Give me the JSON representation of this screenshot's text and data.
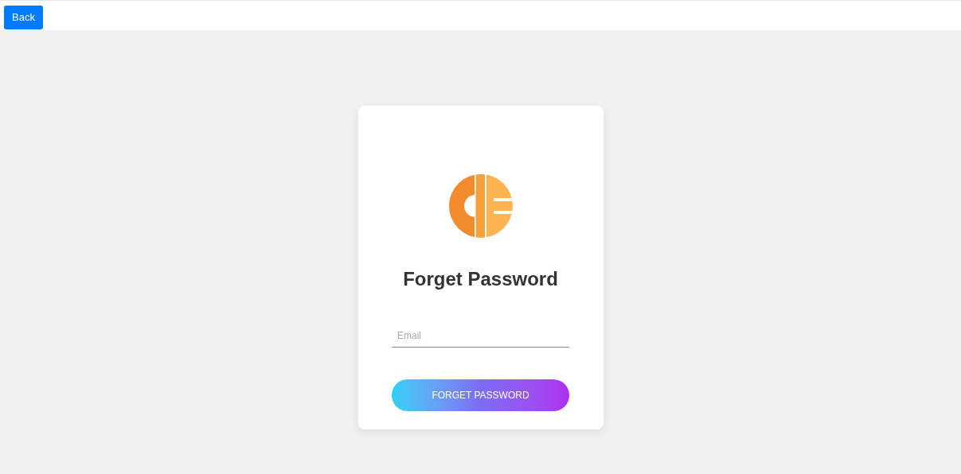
{
  "back_button": {
    "label": "Back"
  },
  "card": {
    "title": "Forget Password",
    "email": {
      "placeholder": "Email"
    },
    "submit_button": {
      "label": "FORGET PASSWORD"
    }
  }
}
